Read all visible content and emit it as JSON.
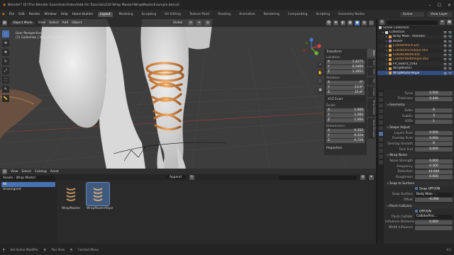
{
  "title_bar": {
    "text": "Blender* [E:\\The Blender Essentials\\Video\\Add-On Tutorials\\218 Wrap Master\\WrapMasterExample.blend]",
    "window_controls": [
      "–",
      "☐",
      "✕"
    ]
  },
  "menubar": {
    "menus": [
      "File",
      "Edit",
      "Render",
      "Window",
      "Help",
      "Home Builder"
    ],
    "workspaces": [
      "Layout",
      "Modeling",
      "Sculpting",
      "UV Editing",
      "Texture Paint",
      "Shading",
      "Animation",
      "Rendering",
      "Compositing",
      "Scripting",
      "Geometry Nodes"
    ],
    "active_workspace": "Layout",
    "scene": "Scene",
    "view_layer": "View Layer"
  },
  "viewport": {
    "mode": "Object Mode",
    "menus": [
      "View",
      "Select",
      "Add",
      "Object"
    ],
    "orientation": "Global",
    "info_line1": "User Perspective",
    "info_line2": "(1) Collection | WrapMasterRope"
  },
  "npanel": {
    "header": "Transform",
    "location_label": "Location:",
    "location": [
      {
        "axis": "X",
        "value": "1.4271"
      },
      {
        "axis": "Y",
        "value": "0.2469"
      },
      {
        "axis": "Z",
        "value": "1.2057"
      }
    ],
    "rotation_label": "Rotation:",
    "rotation": [
      {
        "axis": "X",
        "value": "0°"
      },
      {
        "axis": "Y",
        "value": "-13.9°"
      },
      {
        "axis": "Z",
        "value": "15.9°"
      }
    ],
    "rotation_mode": "XYZ Euler",
    "scale_label": "Scale:",
    "scale": [
      {
        "axis": "X",
        "value": "1.000"
      },
      {
        "axis": "Y",
        "value": "1.000"
      },
      {
        "axis": "Z",
        "value": "1.000"
      }
    ],
    "dimensions_label": "Dimensions:",
    "dimensions": [
      {
        "axis": "X",
        "value": "0.352"
      },
      {
        "axis": "Y",
        "value": "0.354"
      },
      {
        "axis": "Z",
        "value": "0.729"
      }
    ],
    "properties_label": "Properties",
    "tabs": [
      "Item",
      "Tool",
      "View",
      "Edit",
      "Create",
      "Wrap Master",
      "Node Wrangler"
    ]
  },
  "asset_browser": {
    "menus": [
      "View",
      "Select",
      "Catalog",
      "Asset"
    ],
    "append_label": "Append",
    "library": "Assets - Wrap Master",
    "categories": [
      "All",
      "Unassigned"
    ],
    "active_category": "All",
    "search_placeholder": "",
    "assets": [
      {
        "name": "WrapMaster"
      },
      {
        "name": "WrapMasterRope"
      }
    ],
    "selected_asset": "WrapMasterRope"
  },
  "outliner": {
    "root": "Scene Collection",
    "items": [
      {
        "name": "Collection",
        "indent": 1,
        "color": "#dddddd",
        "style": ""
      },
      {
        "name": "Body Male - Realistic",
        "indent": 2,
        "color": "#e6a34a",
        "style": ""
      },
      {
        "name": "Bezier",
        "indent": 2,
        "color": "#9c77d7",
        "style": ""
      },
      {
        "name": "ColliderPinch325",
        "indent": 2,
        "color": "#e6a34a",
        "style": "orange"
      },
      {
        "name": "ColliderPinchRope.002",
        "indent": 2,
        "color": "#e6a34a",
        "style": "orange"
      },
      {
        "name": "ColliderWidth305",
        "indent": 2,
        "color": "#e6a34a",
        "style": "orange"
      },
      {
        "name": "ColliderWidthRope.002",
        "indent": 2,
        "color": "#e6a34a",
        "style": "orange"
      },
      {
        "name": "FP_Sword_5583",
        "indent": 2,
        "color": "#e6a34a",
        "style": ""
      },
      {
        "name": "WrapMaster",
        "indent": 2,
        "color": "#e6a34a",
        "style": ""
      },
      {
        "name": "WrapMasterRope",
        "indent": 2,
        "color": "#e6a34a",
        "style": "sel"
      }
    ]
  },
  "properties": {
    "rows_top": [
      {
        "label": "Turns",
        "value": "2.500"
      },
      {
        "label": "Thickness",
        "value": "0.340"
      }
    ],
    "sections": [
      {
        "title": "Geometry",
        "rows": [
          {
            "label": "Sides",
            "value": "6"
          },
          {
            "label": "Subdiv",
            "value": "3"
          },
          {
            "label": "LODs",
            "value": "1"
          }
        ]
      },
      {
        "title": "Shape Adjust",
        "rows": [
          {
            "label": "Layers Push",
            "value": "0.000"
          },
          {
            "label": "Overlap Push",
            "value": "0.000"
          },
          {
            "label": "Overlap Smooth",
            "value": "8"
          },
          {
            "label": "Tuck End",
            "value": "0.000"
          }
        ]
      },
      {
        "title": "Wrap Noise",
        "rows": [
          {
            "label": "Noise Strength",
            "value": "0.000"
          },
          {
            "label": "Frequency",
            "value": "0.300"
          },
          {
            "label": "Distortion",
            "value": "10.000"
          },
          {
            "label": "Roughness",
            "value": "0.000"
          }
        ]
      },
      {
        "title": "Snap to Surface",
        "rows": [
          {
            "label": "",
            "value": "Snap OFF/ON",
            "type": "check"
          },
          {
            "label": "Snap Surface",
            "value": "Body Male -...",
            "type": "dark"
          },
          {
            "label": "Offset",
            "value": "-0.090"
          }
        ]
      },
      {
        "title": "Pinch Collision",
        "rows": [
          {
            "label": "",
            "value": "OFF/ON",
            "type": "check"
          },
          {
            "label": "Pinch Collider",
            "value": "ColliderPinc...",
            "type": "dark"
          },
          {
            "label": "Influence Distance",
            "value": "0.000"
          },
          {
            "label": "Width Influence",
            "value": ""
          }
        ]
      }
    ]
  },
  "statusbar": {
    "items": [
      "Set Active Modifier",
      "Pan View",
      "Context Menu"
    ],
    "version": "4.1"
  }
}
